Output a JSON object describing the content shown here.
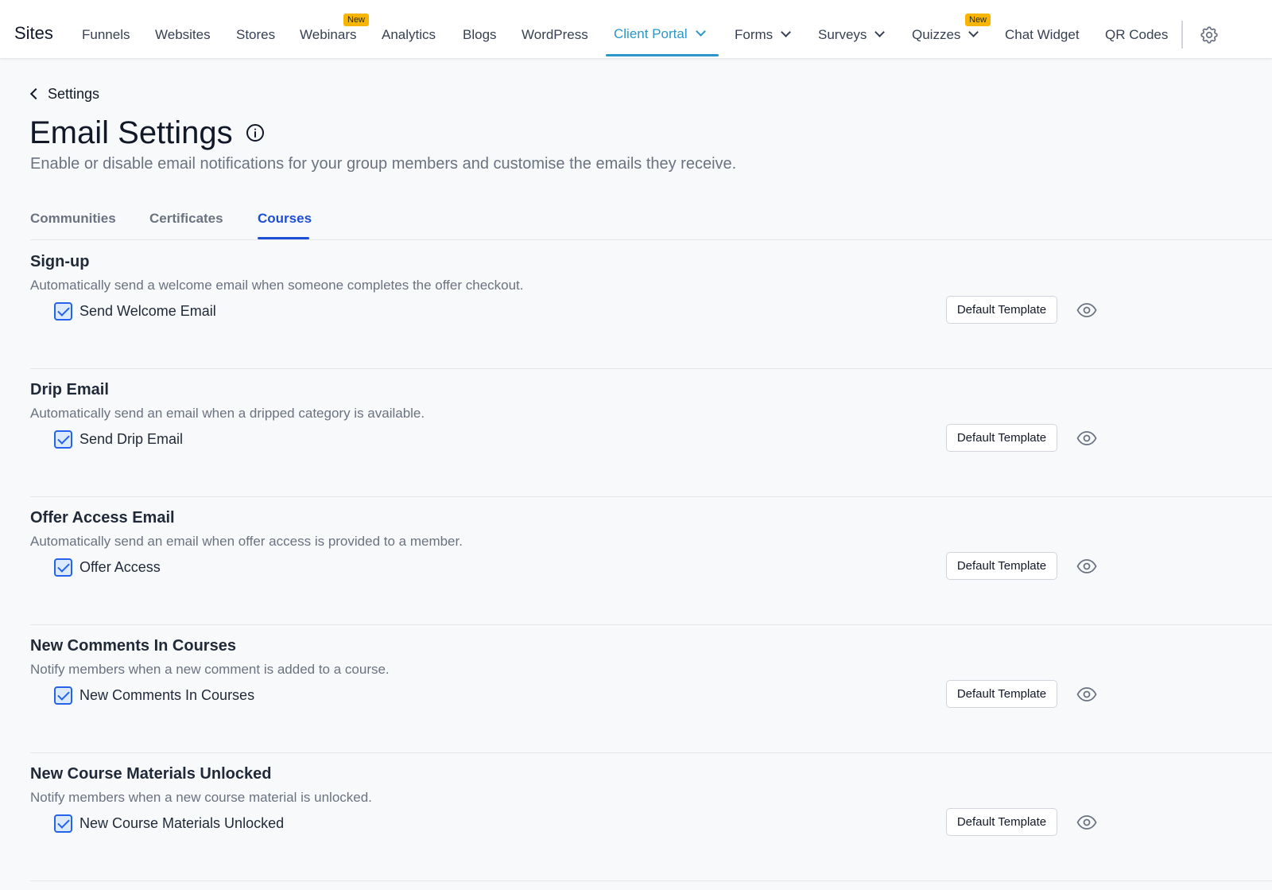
{
  "app": {
    "brand": "Sites"
  },
  "nav": {
    "items": [
      {
        "label": "Funnels"
      },
      {
        "label": "Websites"
      },
      {
        "label": "Stores"
      },
      {
        "label": "Webinars",
        "badge": "New"
      },
      {
        "label": "Analytics"
      },
      {
        "label": "Blogs"
      },
      {
        "label": "WordPress"
      },
      {
        "label": "Client Portal",
        "active": true,
        "dropdown": true
      },
      {
        "label": "Forms",
        "dropdown": true
      },
      {
        "label": "Surveys",
        "dropdown": true
      },
      {
        "label": "Quizzes",
        "badge": "New",
        "dropdown": true
      },
      {
        "label": "Chat Widget"
      },
      {
        "label": "QR Codes"
      }
    ],
    "settings_icon": "gear-icon"
  },
  "page": {
    "back_label": "Settings",
    "title": "Email Settings",
    "subtitle": "Enable or disable email notifications for your group members and customise the emails they receive."
  },
  "tabs": [
    {
      "label": "Communities"
    },
    {
      "label": "Certificates"
    },
    {
      "label": "Courses",
      "active": true
    }
  ],
  "sections": [
    {
      "title": "Sign-up",
      "description": "Automatically send a welcome email when someone completes the offer checkout.",
      "checkbox_label": "Send Welcome Email",
      "checked": true,
      "template_label": "Default Template"
    },
    {
      "title": "Drip Email",
      "description": "Automatically send an email when a dripped category is available.",
      "checkbox_label": "Send Drip Email",
      "checked": true,
      "template_label": "Default Template"
    },
    {
      "title": "Offer Access Email",
      "description": "Automatically send an email when offer access is provided to a member.",
      "checkbox_label": "Offer Access",
      "checked": true,
      "template_label": "Default Template"
    },
    {
      "title": "New Comments In Courses",
      "description": "Notify members when a new comment is added to a course.",
      "checkbox_label": "New Comments In Courses",
      "checked": true,
      "template_label": "Default Template"
    },
    {
      "title": "New Course Materials Unlocked",
      "description": "Notify members when a new course material is unlocked.",
      "checkbox_label": "New Course Materials Unlocked",
      "checked": true,
      "template_label": "Default Template"
    }
  ],
  "colors": {
    "accent": "#2b96c9",
    "tab_active": "#1d4ed8",
    "checkbox": "#2563eb",
    "badge": "#f7b500"
  }
}
